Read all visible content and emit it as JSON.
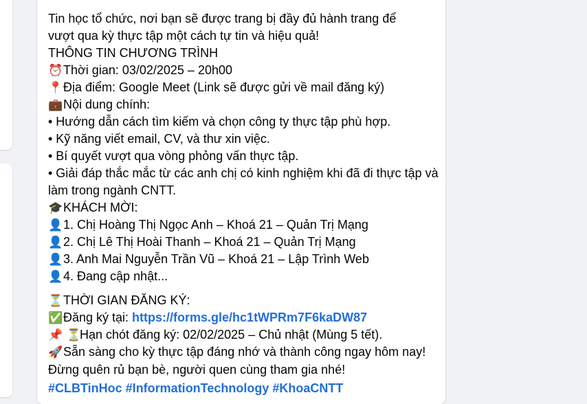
{
  "post": {
    "partial_top": "Tin học tổ chức, nơi bạn sẽ được trang bị đầy đủ hành trang để",
    "intro_line1": "Tin học tổ chức, nơi bạn sẽ được trang bị đầy đủ hành trang để",
    "intro_line2": "vượt qua kỳ thực tập một cách tự tin và hiệu quả!",
    "program_heading": "THÔNG TIN CHƯƠNG TRÌNH",
    "time": {
      "icon": "⏰",
      "text": "Thời gian: 03/02/2025 – 20h00"
    },
    "location": {
      "icon": "📍",
      "text": "Địa điểm: Google Meet (Link sẽ được gửi về mail đăng ký)"
    },
    "content": {
      "icon": "💼",
      "text": "Nội dung chính:"
    },
    "bullets": [
      "• Hướng dẫn cách tìm kiếm và chọn công ty thực tập phù hợp.",
      "• Kỹ năng viết email, CV, và thư xin việc.",
      "• Bí quyết vượt qua vòng phỏng vấn thực tập.",
      "• Giải đáp thắc mắc từ các anh chị có kinh nghiệm khi đã đi thực tập và làm trong ngành CNTT."
    ],
    "guests_heading": {
      "icon": "🎓",
      "text": "KHÁCH MỜI:"
    },
    "guests": [
      {
        "icon": "👤",
        "text": "1. Chị Hoàng Thị Ngọc Anh – Khoá 21 – Quản Trị Mạng"
      },
      {
        "icon": "👤",
        "text": "2. Chị Lê Thị Hoài Thanh – Khoá 21 – Quản Trị Mạng"
      },
      {
        "icon": "👤",
        "text": "3. Anh Mai Nguyễn Trần Vũ – Khoá 21 – Lập Trình Web"
      },
      {
        "icon": "👤",
        "text": "4. Đang cập nhật..."
      }
    ],
    "registration_heading": {
      "icon": "⏳",
      "text": "THỜI GIAN ĐĂNG KÝ:"
    },
    "register": {
      "icon": "✅",
      "label": "Đăng ký tại: ",
      "link": "https://forms.gle/hc1tWPRm7F6kaDW87"
    },
    "deadline": {
      "icon": "📌 ⏳",
      "text": "Hạn chót đăng ký: 02/02/2025 – Chủ nhật (Mùng 5 tết)."
    },
    "closing": {
      "icon": "🚀",
      "text": "Sẵn sàng cho kỳ thực tập đáng nhớ và thành công ngay hôm nay! Đừng quên rủ bạn bè, người quen cùng tham gia nhé!"
    },
    "hashtags": "#CLBTinHoc #InformationTechnology #KhoaCNTT"
  },
  "colors": {
    "link": "#216fdb",
    "background": "#f0f2f5",
    "card": "#ffffff"
  }
}
